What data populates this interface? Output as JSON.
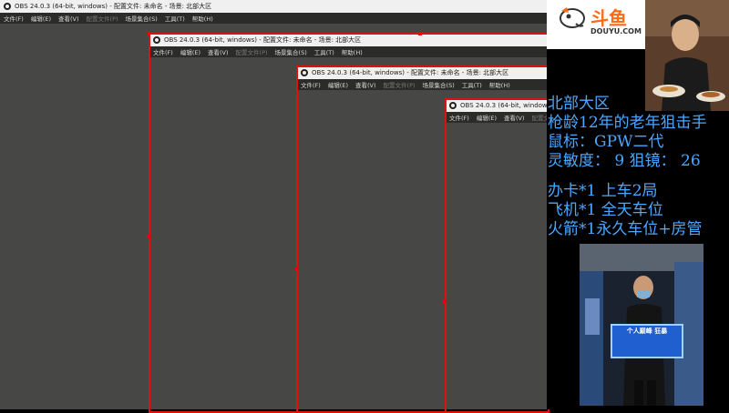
{
  "obs": {
    "title": "OBS 24.0.3 (64-bit, windows) - 配置文件: 未命名 - 场景: 北部大区",
    "menu": [
      {
        "label": "文件(F)",
        "disabled": false
      },
      {
        "label": "编辑(E)",
        "disabled": false
      },
      {
        "label": "查看(V)",
        "disabled": false
      },
      {
        "label": "配置文件(P)",
        "disabled": true
      },
      {
        "label": "场景集合(S)",
        "disabled": false
      },
      {
        "label": "工具(T)",
        "disabled": false
      },
      {
        "label": "帮助(H)",
        "disabled": false
      }
    ]
  },
  "logo": {
    "cn": "斗鱼",
    "en": "DOUYU.COM",
    "brand_color": "#ff6a13"
  },
  "info": {
    "region": "北部大区",
    "experience": "枪龄12年的老年狙击手",
    "mouse": "鼠标：GPW二代",
    "sensitivity": "灵敏度： 9 狙镜： 26",
    "perk1": "办卡*1 上车2局",
    "perk2": "飞机*1 全天车位",
    "perk3": "火箭*1永久车位+房管",
    "text_color": "#4aa8ff"
  },
  "poster": {
    "banner": "个人巅峰 狂暴"
  },
  "colors": {
    "frame": "#dd1111",
    "obs_bg": "#474845"
  }
}
